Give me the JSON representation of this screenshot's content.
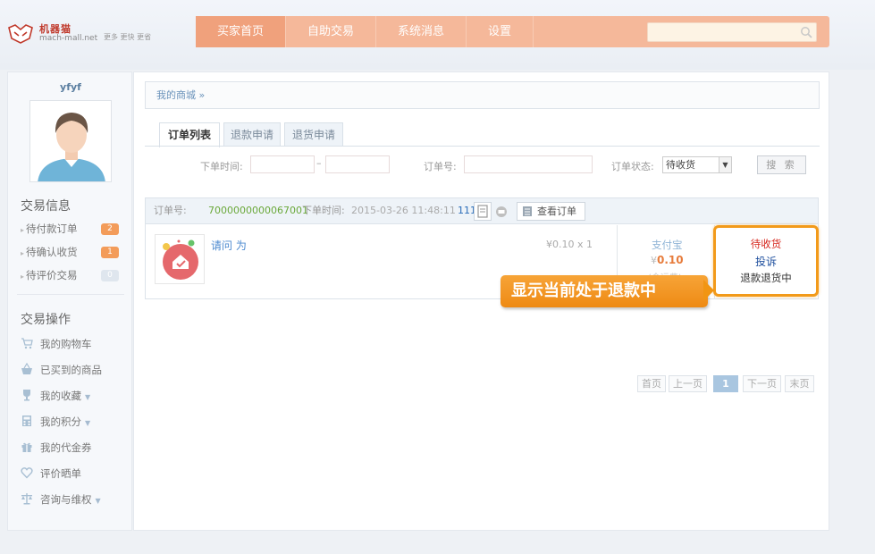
{
  "header": {
    "logo_cn": "机器猫",
    "logo_en": "mach-mall.net",
    "slogan": "更多 更快 更省",
    "nav": [
      "买家首页",
      "自助交易",
      "系统消息",
      "设置"
    ],
    "search_placeholder": ""
  },
  "sidebar": {
    "username": "yfyf",
    "trade_info_title": "交易信息",
    "trade_info": [
      {
        "label": "待付款订单",
        "count": "2",
        "color": "#f39c5a"
      },
      {
        "label": "待确认收货",
        "count": "1",
        "color": "#f39c5a"
      },
      {
        "label": "待评价交易",
        "count": "0",
        "color": "#dfe6ee"
      }
    ],
    "ops_title": "交易操作",
    "ops": [
      {
        "label": "我的购物车",
        "icon": "cart-icon"
      },
      {
        "label": "已买到的商品",
        "icon": "basket-icon"
      },
      {
        "label": "我的收藏",
        "icon": "trophy-icon",
        "dropdown": true
      },
      {
        "label": "我的积分",
        "icon": "calculator-icon",
        "dropdown": true
      },
      {
        "label": "我的代金券",
        "icon": "gift-icon"
      },
      {
        "label": "评价晒单",
        "icon": "heart-icon"
      },
      {
        "label": "咨询与维权",
        "icon": "scale-icon",
        "dropdown": true
      }
    ]
  },
  "main": {
    "breadcrumb": "我的商城 »",
    "tabs": [
      "订单列表",
      "退款申请",
      "退货申请"
    ],
    "filter": {
      "time_label": "下单时间:",
      "time_sep": "–",
      "order_no_label": "订单号:",
      "status_label": "订单状态:",
      "status_value": "待收货",
      "search_label": "搜 索"
    },
    "order": {
      "no_label": "订单号:",
      "no": "7000000000067001",
      "time_label": "下单时间:",
      "time": "2015-03-26 11:48:11",
      "extra": "111",
      "view_label": "查看订单",
      "goods_name": "请问 为",
      "price": "¥0.10 x 1",
      "pay_method": "支付宝",
      "amount_yen": "¥",
      "amount": "0.10",
      "pay_note": "(含运费)",
      "status": "待收货",
      "complaint": "投诉",
      "refund_status": "退款退货中"
    },
    "callout": "显示当前处于退款中",
    "pager": [
      "首页",
      "上一页",
      "1",
      "下一页",
      "末页"
    ]
  }
}
